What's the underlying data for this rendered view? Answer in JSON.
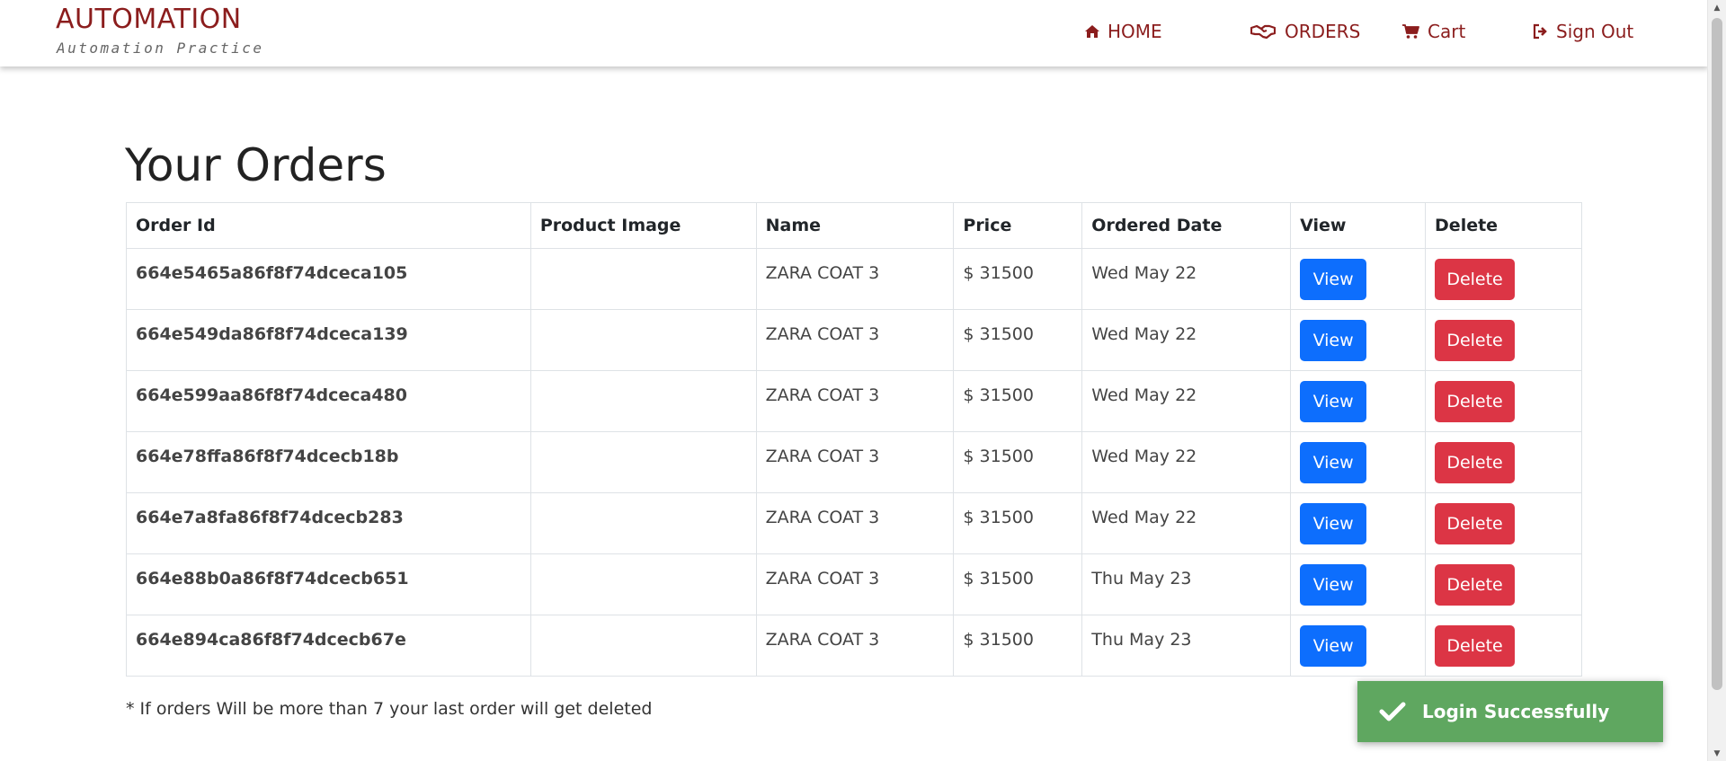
{
  "brand": {
    "title": "AUTOMATION",
    "subtitle": "Automation Practice"
  },
  "nav": {
    "home": "HOME",
    "orders": "ORDERS",
    "cart": "Cart",
    "signout": "Sign Out"
  },
  "icons": {
    "home": "home-icon",
    "orders": "handshake-icon",
    "cart": "cart-icon",
    "signout": "sign-out-icon",
    "toast": "checkmark-icon"
  },
  "colors": {
    "brand": "#8b1d1d",
    "view_button": "#0d6efd",
    "delete_button": "#dc3545",
    "toast": "#5fa760"
  },
  "page": {
    "title": "Your Orders"
  },
  "table": {
    "headers": [
      "Order Id",
      "Product Image",
      "Name",
      "Price",
      "Ordered Date",
      "View",
      "Delete"
    ],
    "rows": [
      {
        "order_id": "664e5465a86f8f74dceca105",
        "product_image": "",
        "name": "ZARA COAT 3",
        "price": "$ 31500",
        "date": "Wed May 22",
        "view": "View",
        "delete": "Delete"
      },
      {
        "order_id": "664e549da86f8f74dceca139",
        "product_image": "",
        "name": "ZARA COAT 3",
        "price": "$ 31500",
        "date": "Wed May 22",
        "view": "View",
        "delete": "Delete"
      },
      {
        "order_id": "664e599aa86f8f74dceca480",
        "product_image": "",
        "name": "ZARA COAT 3",
        "price": "$ 31500",
        "date": "Wed May 22",
        "view": "View",
        "delete": "Delete"
      },
      {
        "order_id": "664e78ffa86f8f74dcecb18b",
        "product_image": "",
        "name": "ZARA COAT 3",
        "price": "$ 31500",
        "date": "Wed May 22",
        "view": "View",
        "delete": "Delete"
      },
      {
        "order_id": "664e7a8fa86f8f74dcecb283",
        "product_image": "",
        "name": "ZARA COAT 3",
        "price": "$ 31500",
        "date": "Wed May 22",
        "view": "View",
        "delete": "Delete"
      },
      {
        "order_id": "664e88b0a86f8f74dcecb651",
        "product_image": "",
        "name": "ZARA COAT 3",
        "price": "$ 31500",
        "date": "Thu May 23",
        "view": "View",
        "delete": "Delete"
      },
      {
        "order_id": "664e894ca86f8f74dcecb67e",
        "product_image": "",
        "name": "ZARA COAT 3",
        "price": "$ 31500",
        "date": "Thu May 23",
        "view": "View",
        "delete": "Delete"
      }
    ]
  },
  "note": "* If orders Will be more than 7 your last order will get deleted",
  "toast": {
    "message": "Login Successfully"
  }
}
